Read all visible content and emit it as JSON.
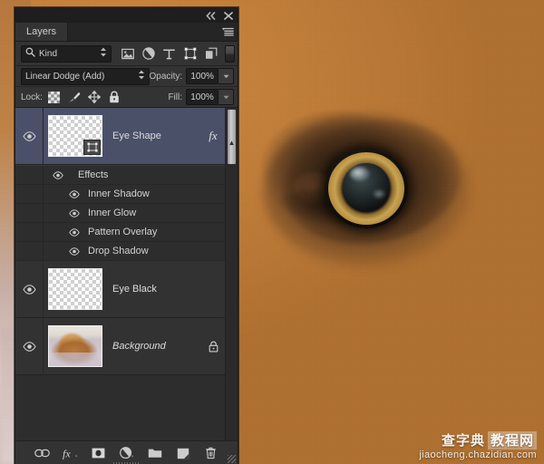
{
  "window": {
    "collapse_icon": "double-chevron-left-icon",
    "close_icon": "close-icon"
  },
  "panel": {
    "tab_label": "Layers",
    "menu_icon": "panel-menu-icon"
  },
  "filter_row": {
    "kind_label": "Kind",
    "search_icon": "search-icon",
    "stepper_icon": "updown-stepper-icon",
    "icons": [
      {
        "name": "filter-pixel-icon",
        "title": "Pixel layers"
      },
      {
        "name": "filter-adjustment-icon",
        "title": "Adjustment layers"
      },
      {
        "name": "filter-type-icon",
        "title": "Type layers"
      },
      {
        "name": "filter-shape-icon",
        "title": "Shape layers"
      },
      {
        "name": "filter-smartobject-icon",
        "title": "Smart objects"
      }
    ],
    "toggle_name": "filter-toggle-switch"
  },
  "blend_row": {
    "mode": "Linear Dodge (Add)",
    "opacity_label": "Opacity:",
    "opacity_value": "100%"
  },
  "lock_row": {
    "lock_label": "Lock:",
    "icons": [
      {
        "name": "lock-transparency-icon"
      },
      {
        "name": "lock-image-pixels-icon"
      },
      {
        "name": "lock-position-icon"
      },
      {
        "name": "lock-all-icon"
      }
    ],
    "fill_label": "Fill:",
    "fill_value": "100%"
  },
  "layers": [
    {
      "name": "Eye Shape",
      "selected": true,
      "visible": true,
      "thumb": "transparent",
      "has_vector_badge": true,
      "fx_badge": "fx",
      "italic": false,
      "locked": false
    },
    {
      "name": "Eye Black",
      "selected": false,
      "visible": true,
      "thumb": "transparent",
      "has_vector_badge": false,
      "fx_badge": "",
      "italic": false,
      "locked": false
    },
    {
      "name": "Background",
      "selected": false,
      "visible": true,
      "thumb": "photo",
      "has_vector_badge": false,
      "fx_badge": "",
      "italic": true,
      "locked": true
    }
  ],
  "effects": {
    "group_label": "Effects",
    "items": [
      "Inner Shadow",
      "Inner Glow",
      "Pattern Overlay",
      "Drop Shadow"
    ]
  },
  "footer": {
    "buttons": [
      {
        "name": "link-layers-button",
        "icon": "link-icon"
      },
      {
        "name": "layer-style-button",
        "icon": "fx-icon",
        "label": "fx"
      },
      {
        "name": "add-layer-mask-button",
        "icon": "mask-icon"
      },
      {
        "name": "new-adjustment-layer-button",
        "icon": "half-circle-icon"
      },
      {
        "name": "new-group-button",
        "icon": "folder-icon"
      },
      {
        "name": "new-layer-button",
        "icon": "new-layer-icon"
      },
      {
        "name": "delete-layer-button",
        "icon": "trash-icon"
      }
    ]
  },
  "watermark": {
    "text_main": "查字典",
    "text_boxed": "教程网",
    "url": "jiaocheng.chazidian.com"
  },
  "colors": {
    "panel_bg": "#2b2b2b",
    "row_bg": "#323232",
    "selected_row": "#4a5068",
    "text": "#dcdcdc",
    "canvas_fur": "#c98a4d"
  }
}
